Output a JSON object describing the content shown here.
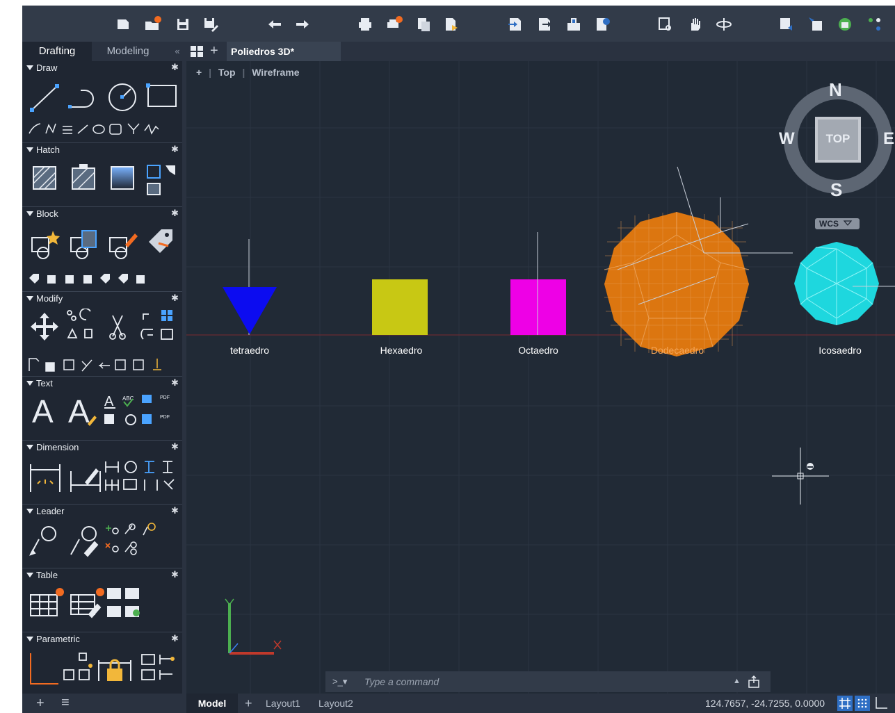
{
  "palette": {
    "tabs": [
      "Drafting",
      "Modeling"
    ],
    "collapse": "«",
    "sections": [
      "Draw",
      "Hatch",
      "Block",
      "Modify",
      "Text",
      "Dimension",
      "Leader",
      "Table",
      "Parametric"
    ],
    "gear": "✱",
    "add": "+",
    "menu": "≡"
  },
  "document": {
    "grid_icon": "grid-icon",
    "add": "+",
    "title": "Poliedros 3D*"
  },
  "viewport": {
    "plus": "+",
    "view": "Top",
    "style": "Wireframe"
  },
  "objects": [
    {
      "label": "tetraedro",
      "color": "#0c0cf0"
    },
    {
      "label": "Hexaedro",
      "color": "#c8c814"
    },
    {
      "label": "Octaedro",
      "color": "#ee00e6"
    },
    {
      "label": "Dodecaedro",
      "color": "#dc7610",
      "label_color": "#f5a75a"
    },
    {
      "label": "Icosaedro",
      "color": "#1ed7de"
    }
  ],
  "viewcube": {
    "north": "N",
    "south": "S",
    "east": "E",
    "west": "W",
    "face": "TOP",
    "wcs": "WCS"
  },
  "command": {
    "prompt": ">_▾",
    "placeholder": "Type a command",
    "history": "▲"
  },
  "status": {
    "tabs": [
      "Model",
      "Layout1",
      "Layout2"
    ],
    "add": "+",
    "coords": "124.7657, -24.7255, 0.0000"
  },
  "colors": {
    "background": "#212a36",
    "toolbar": "#323b49",
    "accent": "#2f6fc4",
    "orange_dot": "#f26b21"
  }
}
